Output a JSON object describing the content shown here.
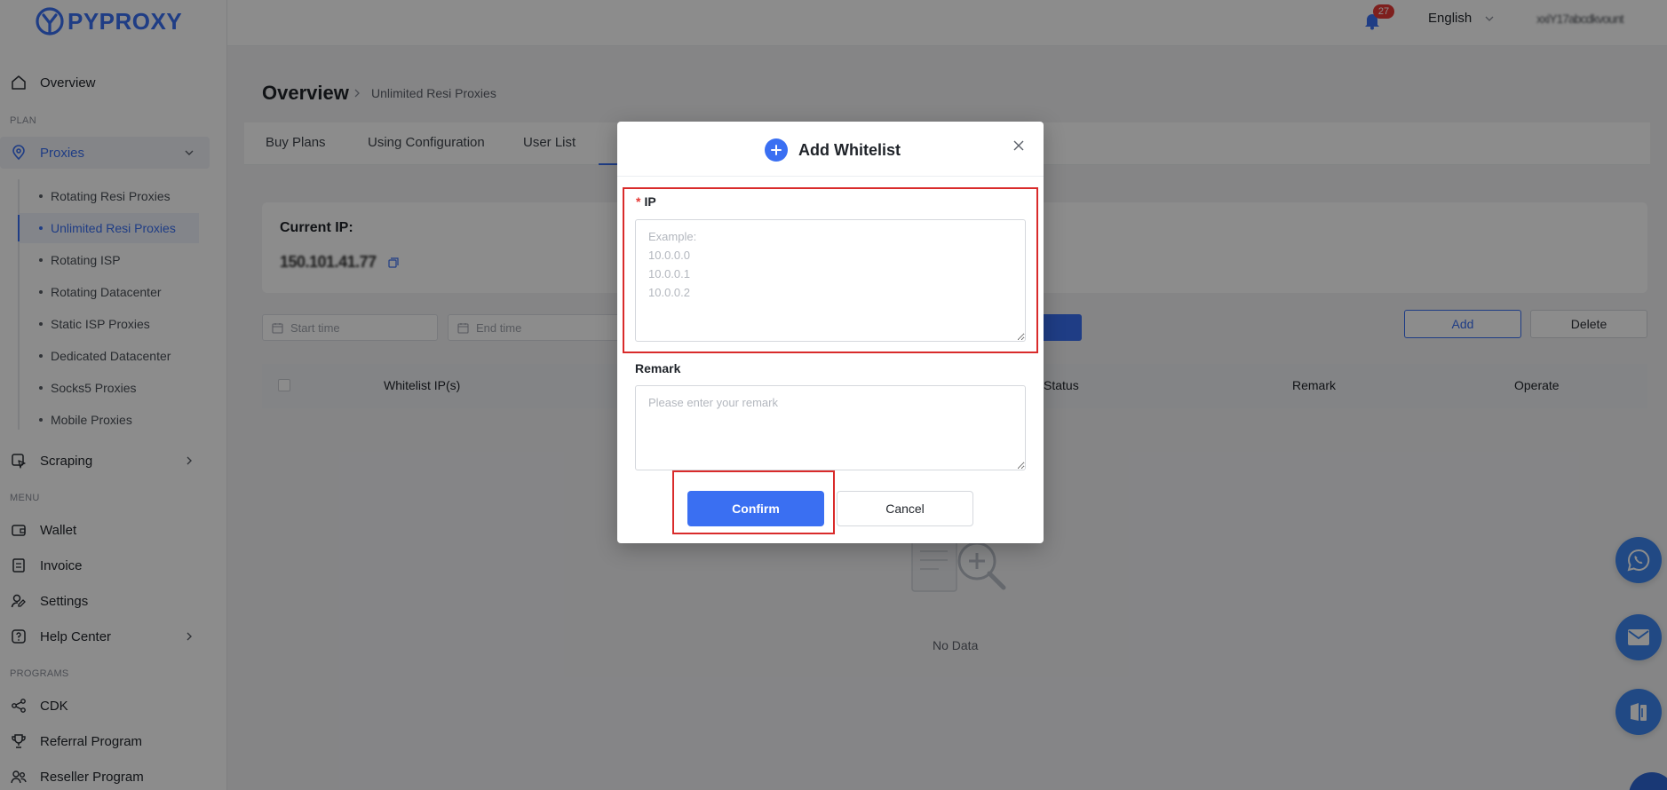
{
  "brand": {
    "logo_text": "PYPROXY"
  },
  "topbar": {
    "notification_count": "27",
    "language": "English",
    "username": "xxiY17abcdkvount"
  },
  "sidebar": {
    "overview": "Overview",
    "section_plan": "PLAN",
    "proxies": "Proxies",
    "proxies_sub": [
      "Rotating Resi Proxies",
      "Unlimited Resi Proxies",
      "Rotating ISP",
      "Rotating Datacenter",
      "Static ISP Proxies",
      "Dedicated Datacenter",
      "Socks5 Proxies",
      "Mobile Proxies"
    ],
    "scraping": "Scraping",
    "section_menu": "MENU",
    "wallet": "Wallet",
    "invoice": "Invoice",
    "settings": "Settings",
    "help_center": "Help Center",
    "section_programs": "PROGRAMS",
    "cdk": "CDK",
    "referral": "Referral Program",
    "reseller": "Reseller Program"
  },
  "main": {
    "page_title": "Overview",
    "breadcrumb": "Unlimited Resi Proxies",
    "tabs": [
      "Buy Plans",
      "Using Configuration",
      "User List"
    ],
    "current_ip_label": "Current IP:",
    "current_ip_value": "150.101.41.77",
    "start_time_placeholder": "Start time",
    "end_time_placeholder": "End time",
    "add_label": "Add",
    "delete_label": "Delete",
    "table_headers": [
      "Whitelist IP(s)",
      "Status",
      "Remark",
      "Operate"
    ],
    "no_data": "No Data"
  },
  "modal": {
    "title": "Add Whitelist",
    "ip_label": "IP",
    "ip_required_mark": "*",
    "ip_placeholder": "Example:\n10.0.0.0\n10.0.0.1\n10.0.0.2",
    "remark_label": "Remark",
    "remark_placeholder": "Please enter your remark",
    "confirm_label": "Confirm",
    "cancel_label": "Cancel"
  },
  "colors": {
    "accent": "#3a6ff2",
    "highlight": "#d92b2b",
    "badge": "#e53935"
  }
}
